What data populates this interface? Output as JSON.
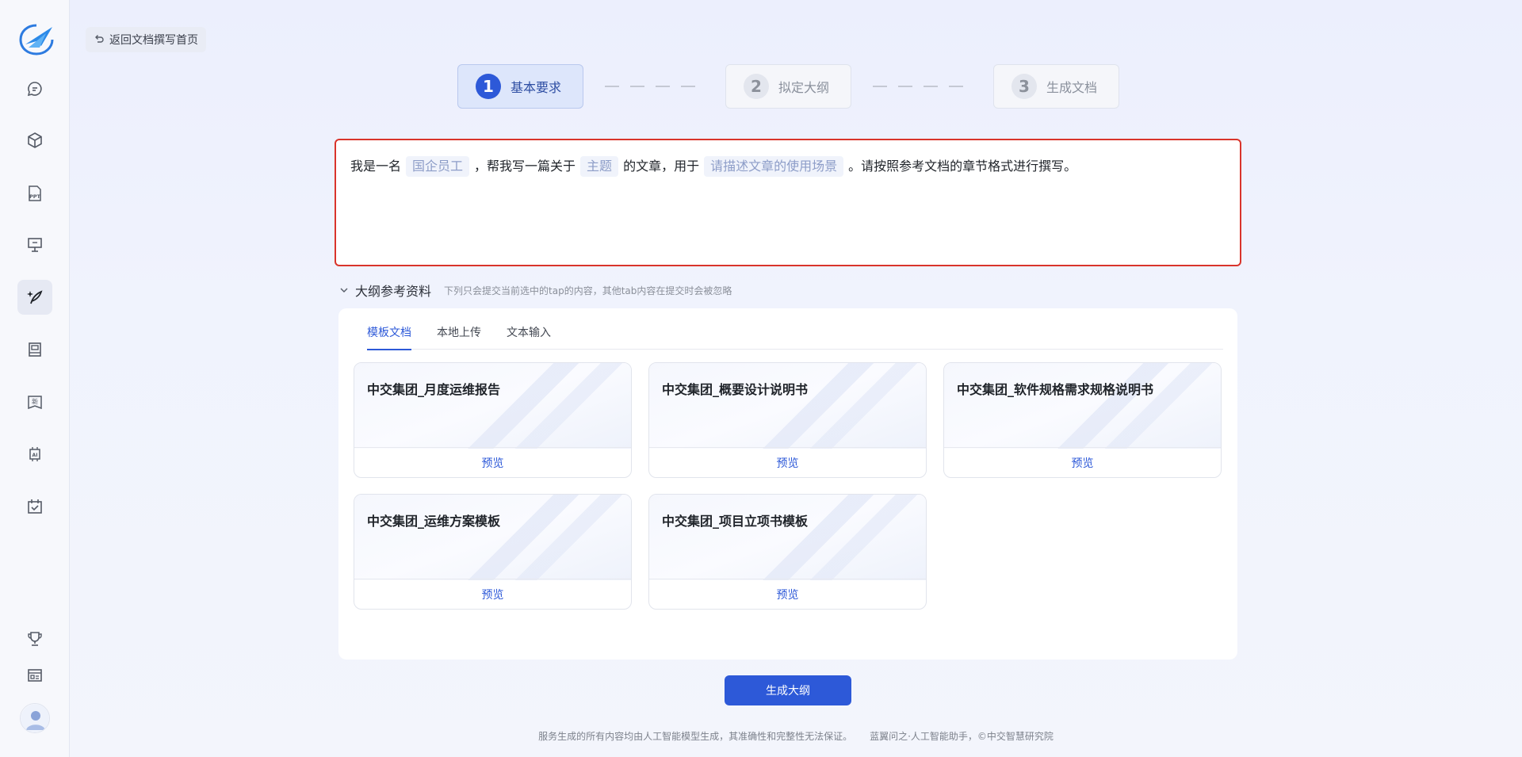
{
  "sidebar": {
    "items": [
      {
        "icon": "chat-icon"
      },
      {
        "icon": "cube-icon"
      },
      {
        "icon": "ppt-icon"
      },
      {
        "icon": "presentation-icon"
      },
      {
        "icon": "pen-sparkle-icon",
        "active": true
      },
      {
        "icon": "book-icon"
      },
      {
        "icon": "news-icon"
      },
      {
        "icon": "ai-chip-icon"
      },
      {
        "icon": "calendar-check-icon"
      }
    ],
    "bottom_items": [
      {
        "icon": "trophy-icon"
      },
      {
        "icon": "window-icon"
      }
    ]
  },
  "header": {
    "back_label": "返回文档撰写首页"
  },
  "steps": [
    {
      "num": "1",
      "label": "基本要求",
      "active": true
    },
    {
      "num": "2",
      "label": "拟定大纲",
      "active": false
    },
    {
      "num": "3",
      "label": "生成文档",
      "active": false
    }
  ],
  "prompt": {
    "part1": "我是一名",
    "slot1": "国企员工",
    "part2": "，帮我写一篇关于",
    "slot2": "主题",
    "part3": "的文章，用于",
    "slot3": "请描述文章的使用场景",
    "part4": "。请按照参考文档的章节格式进行撰写。"
  },
  "reference": {
    "title": "大纲参考资料",
    "note": "下列只会提交当前选中的tap的内容，其他tab内容在提交时会被忽略",
    "tabs": [
      "模板文档",
      "本地上传",
      "文本输入"
    ],
    "active_tab": 0,
    "cards": [
      {
        "title": "中交集团_月度运维报告",
        "action": "预览"
      },
      {
        "title": "中交集团_概要设计说明书",
        "action": "预览"
      },
      {
        "title": "中交集团_软件规格需求规格说明书",
        "action": "预览"
      },
      {
        "title": "中交集团_运维方案模板",
        "action": "预览"
      },
      {
        "title": "中交集团_项目立项书模板",
        "action": "预览"
      }
    ]
  },
  "generate_label": "生成大纲",
  "footer": {
    "disclaimer": "服务生成的所有内容均由人工智能模型生成，其准确性和完整性无法保证。",
    "copyright": "蓝翼问之·人工智能助手，©中交智慧研究院"
  },
  "colors": {
    "accent": "#2d59d8",
    "error_border": "#d9342b"
  }
}
